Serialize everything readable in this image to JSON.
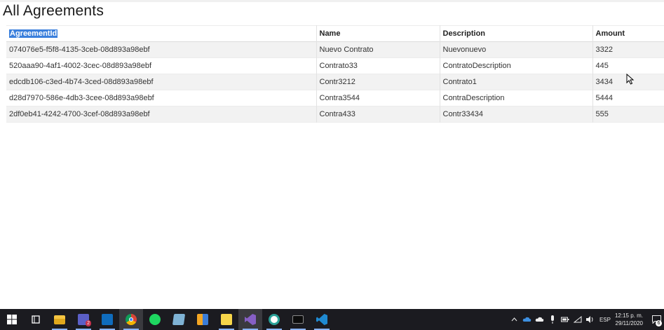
{
  "page": {
    "title": "All Agreements"
  },
  "table": {
    "headers": [
      "AgreementId",
      "Name",
      "Description",
      "Amount"
    ],
    "rows": [
      [
        "074076e5-f5f8-4135-3ceb-08d893a98ebf",
        "Nuevo Contrato",
        "Nuevonuevo",
        "3322"
      ],
      [
        "520aaa90-4af1-4002-3cec-08d893a98ebf",
        "Contrato33",
        "ContratoDescription",
        "445"
      ],
      [
        "edcdb106-c3ed-4b74-3ced-08d893a98ebf",
        "Contr3212",
        "Contrato1",
        "3434"
      ],
      [
        "d28d7970-586e-4db3-3cee-08d893a98ebf",
        "Contra3544",
        "ContraDescription",
        "5444"
      ],
      [
        "2df0eb41-4242-4700-3cef-08d893a98ebf",
        "Contra433",
        "Contr33434",
        "555"
      ]
    ]
  },
  "taskbar": {
    "apps": [
      "windows-start-icon",
      "task-view-icon",
      "file-explorer-icon",
      "teams-icon",
      "outlook-icon",
      "chrome-icon",
      "spotify-icon",
      "notepad-icon",
      "app-icon",
      "sticky-notes-icon",
      "visual-studio-icon",
      "app-s-icon",
      "terminal-icon",
      "vscode-icon"
    ],
    "teams_badge": "2",
    "tray": {
      "language": "ESP",
      "time": "12:15 p. m.",
      "date": "29/11/2020",
      "notifications": "6"
    }
  }
}
